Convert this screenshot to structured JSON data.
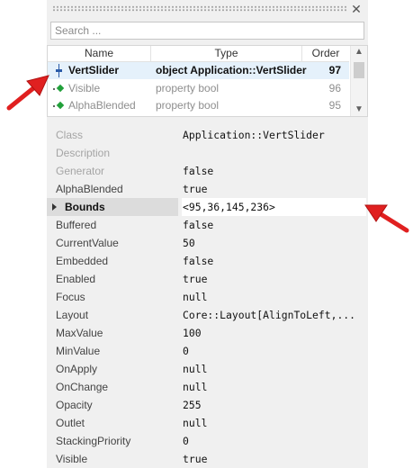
{
  "panel": {
    "close_icon": "close-icon"
  },
  "search": {
    "placeholder": "Search ..."
  },
  "object_list": {
    "columns": [
      "Name",
      "Type",
      "Order"
    ],
    "rows": [
      {
        "name": "VertSlider",
        "type": "object Application::VertSlider",
        "order": "97",
        "icon": "vert-slider-icon",
        "selected": true
      },
      {
        "name": "Visible",
        "type": "property bool",
        "order": "96",
        "icon": "property-icon",
        "selected": false
      },
      {
        "name": "AlphaBlended",
        "type": "property bool",
        "order": "95",
        "icon": "property-icon",
        "selected": false
      }
    ]
  },
  "properties": [
    {
      "label": "Class",
      "value": "Application::VertSlider",
      "dim": false
    },
    {
      "label": "Description",
      "value": "",
      "dim": true
    },
    {
      "label": "Generator",
      "value": "false",
      "dim": false
    },
    {
      "label": "AlphaBlended",
      "value": "true",
      "dim": false
    },
    {
      "label": "Bounds",
      "value": "<95,36,145,236>",
      "dim": false,
      "selected": true
    },
    {
      "label": "Buffered",
      "value": "false",
      "dim": false
    },
    {
      "label": "CurrentValue",
      "value": "50",
      "dim": false
    },
    {
      "label": "Embedded",
      "value": "false",
      "dim": false
    },
    {
      "label": "Enabled",
      "value": "true",
      "dim": false
    },
    {
      "label": "Focus",
      "value": "null",
      "dim": false
    },
    {
      "label": "Layout",
      "value": "Core::Layout[AlignToLeft,...",
      "dim": false
    },
    {
      "label": "MaxValue",
      "value": "100",
      "dim": false
    },
    {
      "label": "MinValue",
      "value": "0",
      "dim": false
    },
    {
      "label": "OnApply",
      "value": "null",
      "dim": false
    },
    {
      "label": "OnChange",
      "value": "null",
      "dim": false
    },
    {
      "label": "Opacity",
      "value": "255",
      "dim": false
    },
    {
      "label": "Outlet",
      "value": "null",
      "dim": false
    },
    {
      "label": "StackingPriority",
      "value": "0",
      "dim": false
    },
    {
      "label": "Visible",
      "value": "true",
      "dim": false
    }
  ],
  "colors": {
    "panel_bg": "#f0f0f0",
    "selection_bg": "#e5f1fb",
    "property_icon": "#21a03a",
    "slider_icon": "#2a5ba8",
    "annotation_arrow": "#e02020"
  }
}
